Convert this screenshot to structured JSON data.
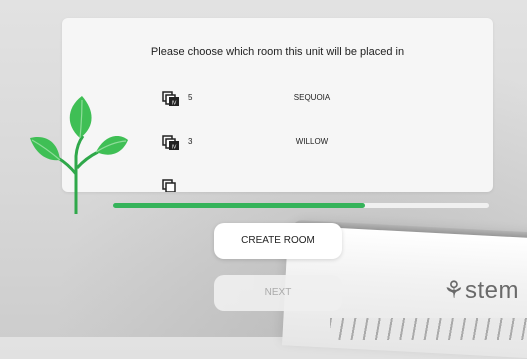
{
  "dialog": {
    "title": "Please choose which room this unit will be placed in",
    "rooms": [
      {
        "count": "5",
        "name": "SEQUOIA"
      },
      {
        "count": "3",
        "name": "WILLOW"
      },
      {
        "count": "",
        "name": ""
      }
    ]
  },
  "progress": {
    "percent": 67,
    "color": "#35b35a"
  },
  "buttons": {
    "create_room": "CREATE ROOM",
    "next": "NEXT"
  },
  "device": {
    "brand": "stem"
  },
  "colors": {
    "accent": "#35b35a",
    "leaf": "#3fbf55",
    "stem": "#2fa84a"
  },
  "icons": {
    "plant": "plant-sprout-icon",
    "room": "room-units-icon"
  }
}
